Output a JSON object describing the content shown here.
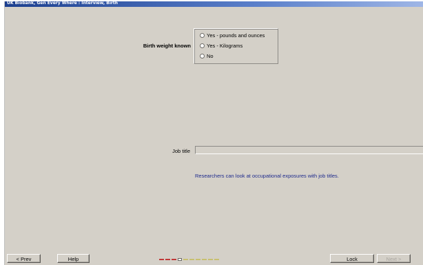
{
  "window": {
    "title": "UK Biobank, Gen Every Where : Interview, Birth"
  },
  "question": {
    "label": "Birth weight known",
    "options": [
      {
        "label": "Yes - pounds and ounces",
        "selected": false
      },
      {
        "label": "Yes - Kilograms",
        "selected": false
      },
      {
        "label": "No",
        "selected": false
      }
    ]
  },
  "job": {
    "label": "Job title",
    "value": "",
    "note": "Researchers can look at occupational exposures with job titles."
  },
  "nav": {
    "prev_label": "< Prev",
    "help_label": "Help",
    "lock_label": "Lock",
    "next_label": "Next >",
    "next_enabled": false
  },
  "progress": {
    "current_step": 4,
    "total_steps": 10,
    "colors": {
      "completed": "#c03838",
      "current": "#ffffff",
      "remaining": "#c8c070"
    }
  },
  "colors": {
    "background": "#d4d0c8",
    "titlebar": "#1c3f8f",
    "note_text": "#1e2a8c"
  }
}
